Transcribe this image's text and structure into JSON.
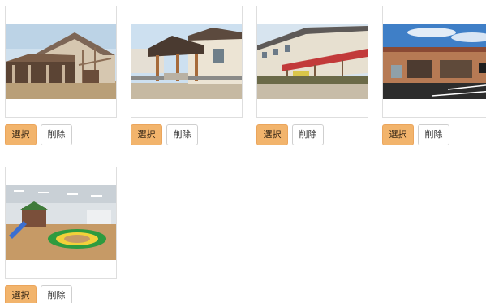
{
  "gallery": {
    "items": [
      {
        "photo": "barn-style-building-photo",
        "select_label": "選択",
        "delete_label": "削除"
      },
      {
        "photo": "wooden-pavilion-building-photo",
        "select_label": "選択",
        "delete_label": "削除"
      },
      {
        "photo": "red-awning-building-photo",
        "select_label": "選択",
        "delete_label": "削除"
      },
      {
        "photo": "shop-with-parking-photo",
        "select_label": "選択",
        "delete_label": "削除"
      },
      {
        "photo": "indoor-playroom-photo",
        "select_label": "選択",
        "delete_label": "削除"
      }
    ]
  },
  "colors": {
    "select_button": "#f2b46c",
    "delete_button": "#ffffff",
    "border": "#dedede"
  }
}
